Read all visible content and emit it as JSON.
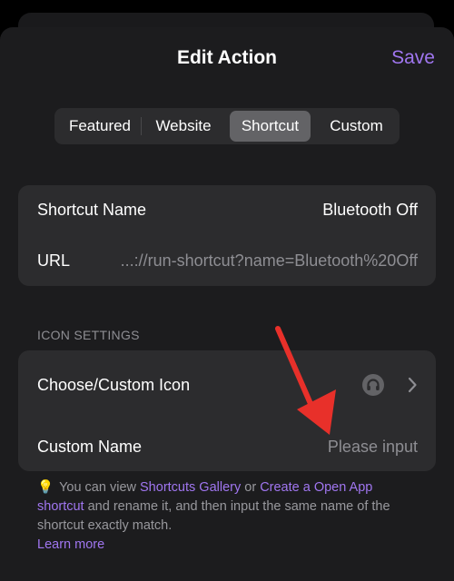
{
  "header": {
    "title": "Edit Action",
    "save_label": "Save"
  },
  "segments": {
    "items": [
      "Featured",
      "Website",
      "Shortcut",
      "Custom"
    ],
    "selected": "Shortcut"
  },
  "shortcut_card": {
    "name_label": "Shortcut Name",
    "name_value": "Bluetooth Off",
    "url_label": "URL",
    "url_value": "...://run-shortcut?name=Bluetooth%20Off"
  },
  "icon_settings": {
    "header": "ICON SETTINGS",
    "choose_label": "Choose/Custom Icon",
    "choose_icon": "shortcuts-app-icon",
    "custom_name_label": "Custom Name",
    "custom_name_placeholder": "Please input"
  },
  "footer": {
    "bulb_icon": "lightbulb-icon",
    "text_1": "You can view ",
    "gallery_link": "Shortcuts Gallery",
    "text_2": " or ",
    "create_link": "Create a Open App shortcut",
    "text_3": " and rename it, and then input the same name of the shortcut exactly match.",
    "learn_more": "Learn more"
  },
  "colors": {
    "accent": "#a076f0",
    "background": "#1c1c1e",
    "card": "#2c2c2e",
    "annotation_arrow": "#e8302a"
  }
}
